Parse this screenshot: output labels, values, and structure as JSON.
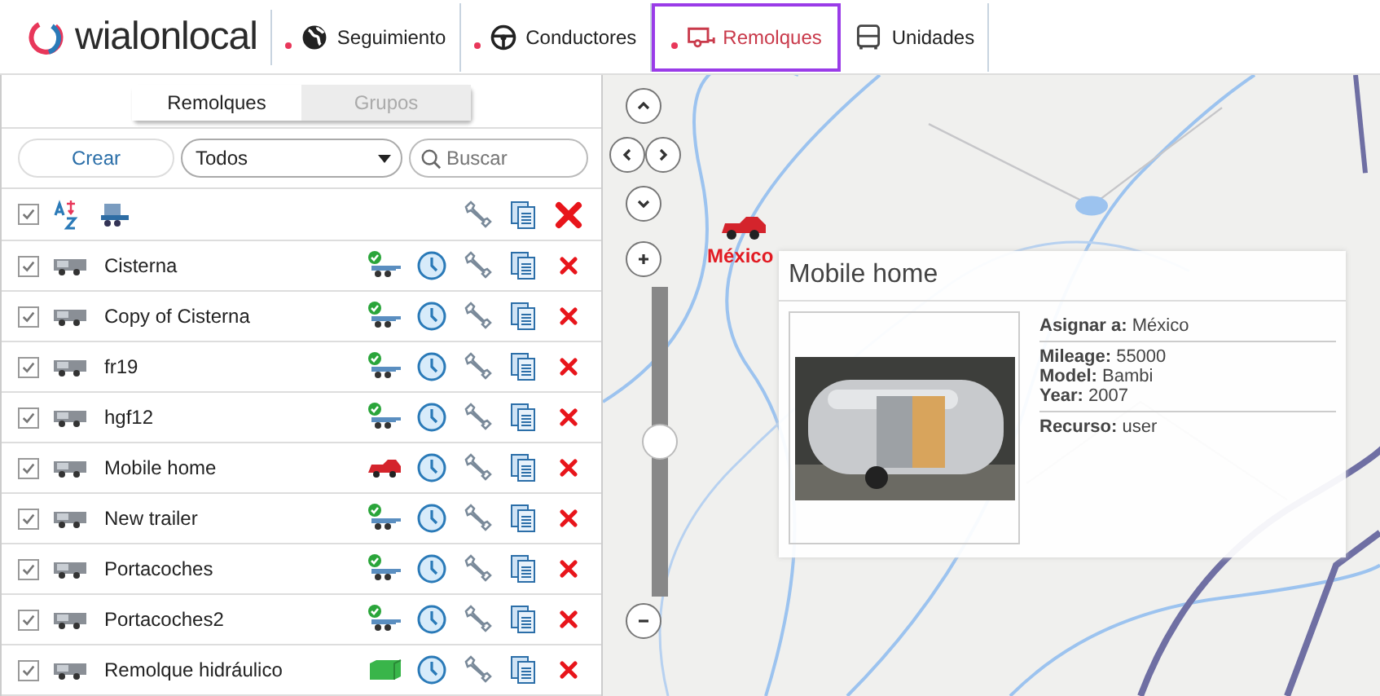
{
  "logo": "wialonlocal",
  "nav": [
    {
      "label": "Seguimiento",
      "kind": "globe",
      "dot": true,
      "selected": false
    },
    {
      "label": "Conductores",
      "kind": "wheel",
      "dot": true,
      "selected": false
    },
    {
      "label": "Remolques",
      "kind": "trailer",
      "dot": true,
      "selected": true
    },
    {
      "label": "Unidades",
      "kind": "bus",
      "dot": false,
      "selected": false
    }
  ],
  "panel_tabs": [
    {
      "label": "Remolques",
      "selected": true
    },
    {
      "label": "Grupos",
      "selected": false
    }
  ],
  "create_button": "Crear",
  "filter": {
    "value": "Todos"
  },
  "search": {
    "placeholder": "Buscar"
  },
  "header_row": {
    "checked": true
  },
  "rows": [
    {
      "name": "Cisterna",
      "checked": true,
      "kind": "trailer"
    },
    {
      "name": "Copy of Cisterna",
      "checked": true,
      "kind": "trailer"
    },
    {
      "name": "fr19",
      "checked": true,
      "kind": "trailer"
    },
    {
      "name": "hgf12",
      "checked": true,
      "kind": "trailer"
    },
    {
      "name": "Mobile home",
      "checked": true,
      "kind": "car"
    },
    {
      "name": "New trailer",
      "checked": true,
      "kind": "trailer"
    },
    {
      "name": "Portacoches",
      "checked": true,
      "kind": "trailer"
    },
    {
      "name": "Portacoches2",
      "checked": true,
      "kind": "trailer"
    },
    {
      "name": "Remolque hidráulico",
      "checked": true,
      "kind": "container"
    }
  ],
  "map": {
    "marker_label": "México",
    "zoom": {
      "level": 0.5
    }
  },
  "popup": {
    "title": "Mobile home",
    "sections": [
      [
        "**Asignar a:** México"
      ],
      [
        "**Mileage:** 55000",
        "**Model:** Bambi",
        "**Year:** 2007"
      ],
      [
        "**Recurso:** user"
      ]
    ]
  }
}
